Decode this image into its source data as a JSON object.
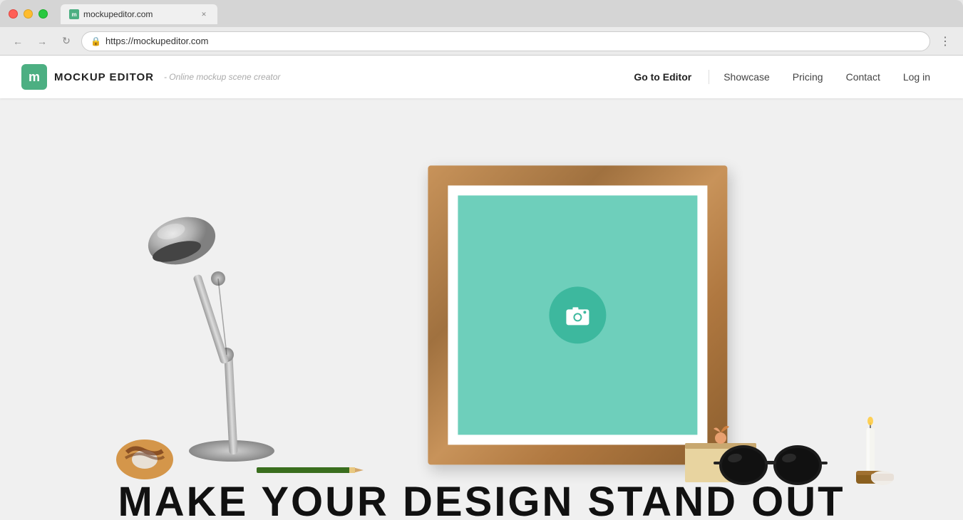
{
  "browser": {
    "url": "https://mockupeditor.com",
    "tab_title": "mockupeditor.com",
    "window_controls": {
      "red": "close",
      "yellow": "minimize",
      "green": "fullscreen"
    },
    "nav": {
      "back": "←",
      "forward": "→",
      "reload": "↻",
      "menu": "⋮"
    }
  },
  "site": {
    "logo": {
      "icon_letter": "m",
      "brand_name": "MOCKUP EDITOR",
      "tagline": "- Online mockup scene creator"
    },
    "nav": {
      "go_to_editor": "Go to Editor",
      "showcase": "Showcase",
      "pricing": "Pricing",
      "contact": "Contact",
      "login": "Log in"
    },
    "hero": {
      "headline": "MAKE YOUR DESIGN STAND OUT"
    }
  },
  "colors": {
    "brand_green": "#4caf82",
    "teal": "#6ecfbb",
    "teal_dark": "#3db89e",
    "wood": "#c8935a"
  }
}
